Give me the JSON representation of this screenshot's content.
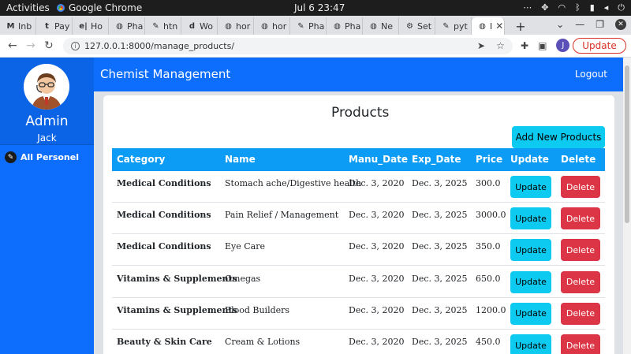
{
  "system": {
    "activities": "Activities",
    "app_name": "Google Chrome",
    "clock": "Jul 6  23:47"
  },
  "browser": {
    "tabs": [
      {
        "icon": "M",
        "label": "Inb"
      },
      {
        "icon": "t",
        "label": "Pay"
      },
      {
        "icon": "e|",
        "label": "Ho"
      },
      {
        "icon": "◍",
        "label": "Pha"
      },
      {
        "icon": "✎",
        "label": "htn"
      },
      {
        "icon": "d",
        "label": "Wo"
      },
      {
        "icon": "◍",
        "label": "hor"
      },
      {
        "icon": "◍",
        "label": "hor"
      },
      {
        "icon": "✎",
        "label": "Pha"
      },
      {
        "icon": "◍",
        "label": "Pha"
      },
      {
        "icon": "◍",
        "label": "Ne"
      },
      {
        "icon": "⚙",
        "label": "Set"
      },
      {
        "icon": "✎",
        "label": "pyt"
      },
      {
        "icon": "◍",
        "label": "I"
      }
    ],
    "new_tab": "+",
    "url": "127.0.0.1:8000/manage_products/",
    "profile_initial": "J",
    "update_label": "Update"
  },
  "sidebar": {
    "admin_title": "Admin",
    "admin_name": "Jack",
    "link_label": "All Personel"
  },
  "navbar": {
    "brand": "Chemist Management",
    "logout": "Logout"
  },
  "main": {
    "title": "Products",
    "add_button": "Add New Products",
    "columns": [
      "Category",
      "Name",
      "Manu_Date",
      "Exp_Date",
      "Price",
      "Update",
      "Delete"
    ],
    "rows": [
      {
        "category": "Medical Conditions",
        "name": "Stomach ache/Digestive health",
        "manu_date": "Dec. 3, 2020",
        "exp_date": "Dec. 3, 2025",
        "price": "300.0",
        "update": "Update",
        "delete": "Delete"
      },
      {
        "category": "Medical Conditions",
        "name": "Pain Relief / Management",
        "manu_date": "Dec. 3, 2020",
        "exp_date": "Dec. 3, 2025",
        "price": "3000.0",
        "update": "Update",
        "delete": "Delete"
      },
      {
        "category": "Medical Conditions",
        "name": "Eye Care",
        "manu_date": "Dec. 3, 2020",
        "exp_date": "Dec. 3, 2025",
        "price": "350.0",
        "update": "Update",
        "delete": "Delete"
      },
      {
        "category": "Vitamins & Supplements",
        "name": "Omegas",
        "manu_date": "Dec. 3, 2020",
        "exp_date": "Dec. 3, 2025",
        "price": "650.0",
        "update": "Update",
        "delete": "Delete"
      },
      {
        "category": "Vitamins & Supplements",
        "name": "Blood Builders",
        "manu_date": "Dec. 3, 2020",
        "exp_date": "Dec. 3, 2025",
        "price": "1200.0",
        "update": "Update",
        "delete": "Delete"
      },
      {
        "category": "Beauty & Skin Care",
        "name": "Cream & Lotions",
        "manu_date": "Dec. 3, 2020",
        "exp_date": "Dec. 3, 2025",
        "price": "450.0",
        "update": "Update",
        "delete": "Delete"
      }
    ]
  },
  "colors": {
    "primary": "#0d6efd",
    "table_header": "#0d9cf5",
    "info_button": "#0dcaf0",
    "danger_button": "#dc3545"
  }
}
